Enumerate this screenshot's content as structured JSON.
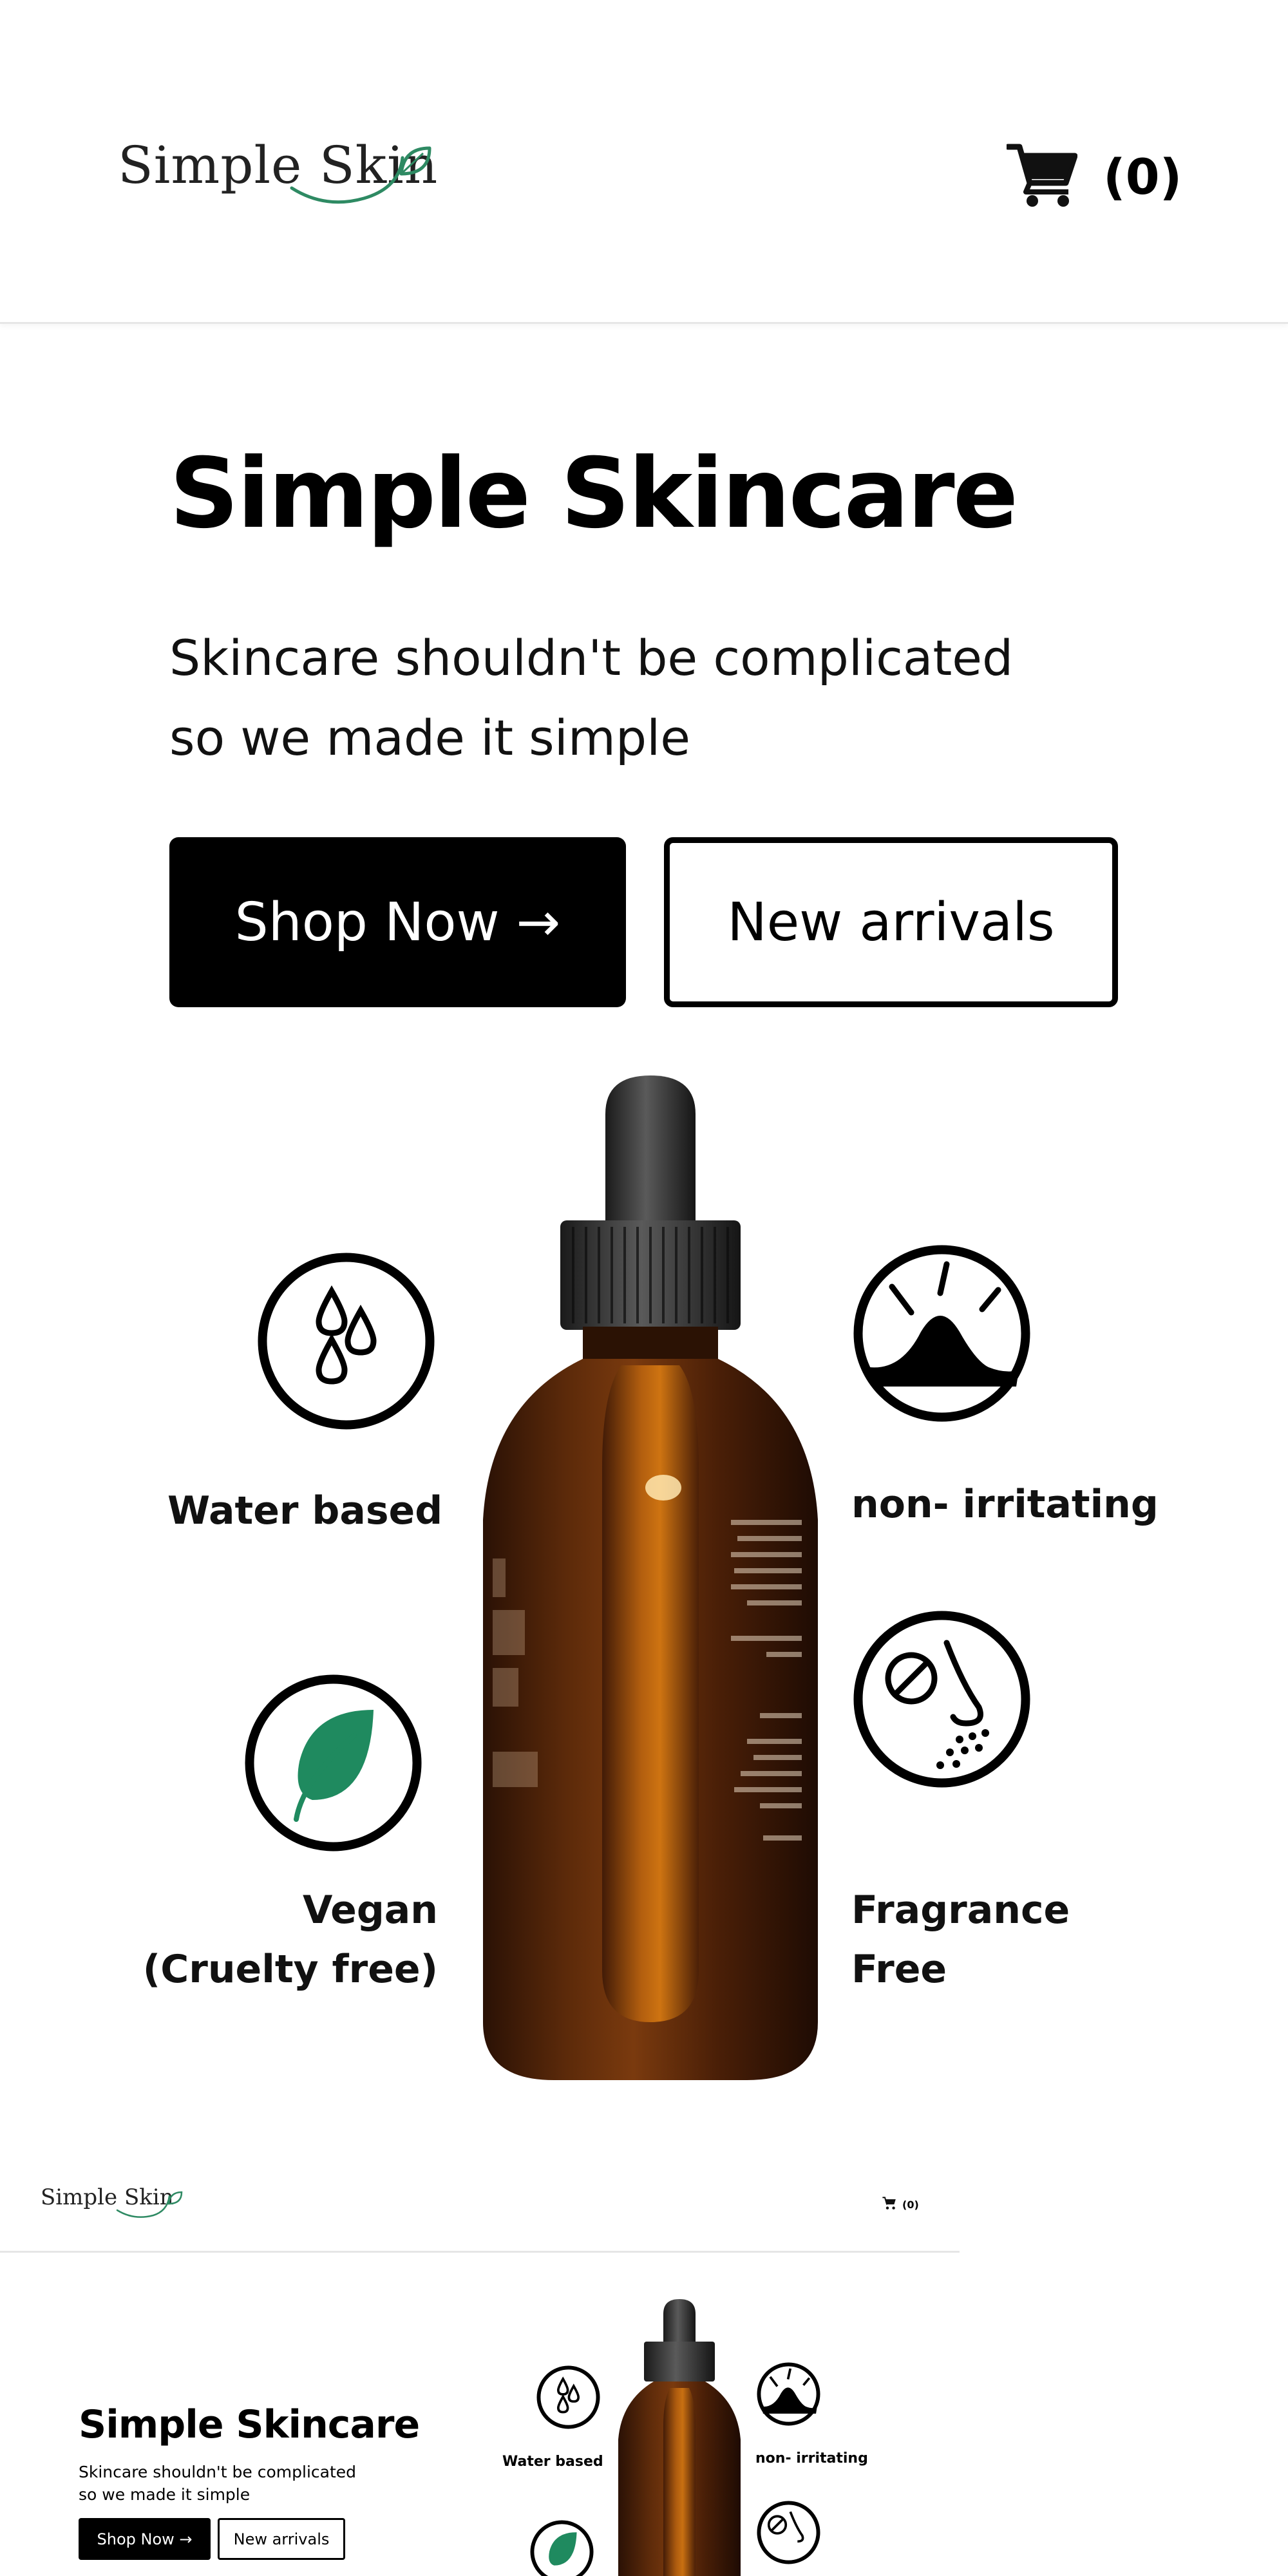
{
  "header": {
    "logo_text": "Simple Skin",
    "logo_icon": "leaf-swash-icon",
    "cart_icon": "shopping-cart-icon",
    "cart_count": "(0)"
  },
  "hero": {
    "title": "Simple Skincare",
    "subtitle_line1": "Skincare shouldn't be complicated",
    "subtitle_line2": "so we made it simple",
    "primary_button": "Shop Now →",
    "secondary_button": "New arrivals"
  },
  "features": {
    "water": {
      "label": "Water based",
      "icon": "water-drops-icon"
    },
    "irritating": {
      "label": "non- irritating",
      "icon": "calm-skin-icon"
    },
    "vegan": {
      "label_line1": "Vegan",
      "label_line2": "(Cruelty free)",
      "icon": "leaf-icon"
    },
    "fragrance": {
      "label_line1": "Fragrance",
      "label_line2": "Free",
      "icon": "no-smell-icon"
    }
  },
  "product": {
    "image": "amber-dropper-bottle"
  },
  "mini_preview": {
    "logo_text": "Simple Skin",
    "cart_count": "(0)",
    "title": "Simple Skincare",
    "subtitle_line1": "Skincare shouldn't be complicated",
    "subtitle_line2": "so we made it simple",
    "primary_button": "Shop Now →",
    "secondary_button": "New arrivals",
    "water_label": "Water based",
    "irritating_label": "non- irritating"
  },
  "colors": {
    "brand_green": "#2e8a63",
    "leaf_green": "#1f8a5f",
    "primary": "#000000",
    "bottle_amber": "#5a2a0a"
  }
}
